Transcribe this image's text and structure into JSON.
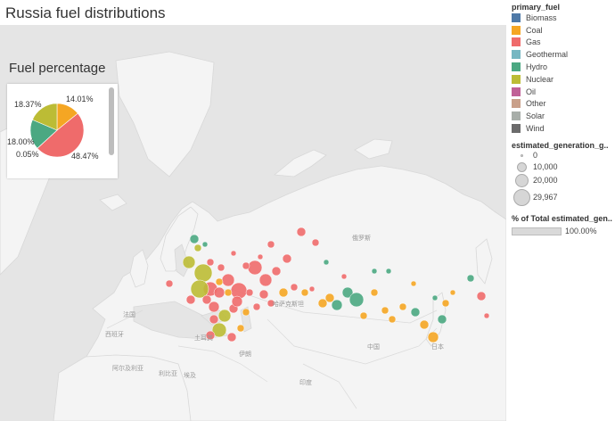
{
  "title": "Russia fuel distributions",
  "inset": {
    "title": "Fuel percentage",
    "labels": {
      "coal": "14.01%",
      "gas": "48.47%",
      "oil": "0.05%",
      "hydro": "18.00%",
      "nuclear": "18.37%"
    }
  },
  "chart_data": {
    "type": "pie",
    "title": "Fuel percentage",
    "slices": [
      {
        "name": "Coal",
        "value": 14.01,
        "color": "#f5a623"
      },
      {
        "name": "Gas",
        "value": 48.47,
        "color": "#ef6b6b"
      },
      {
        "name": "Oil",
        "value": 0.05,
        "color": "#c06096"
      },
      {
        "name": "Hydro",
        "value": 18.0,
        "color": "#4ba882"
      },
      {
        "name": "Nuclear",
        "value": 18.37,
        "color": "#bcbc35"
      }
    ]
  },
  "map_labels": {
    "russia": "俄罗斯",
    "france": "法国",
    "spain": "西班牙",
    "turkey": "土耳其",
    "iran": "伊朗",
    "china": "中国",
    "japan": "日本",
    "algeria": "阿尔及利亚",
    "libya": "利比亚",
    "egypt": "埃及",
    "india": "印度",
    "kazakhstan": "哈萨克斯坦"
  },
  "legend": {
    "color_title": "primary_fuel",
    "items": [
      {
        "label": "Biomass",
        "color": "#4e79a7"
      },
      {
        "label": "Coal",
        "color": "#f5a623"
      },
      {
        "label": "Gas",
        "color": "#ef6b6b"
      },
      {
        "label": "Geothermal",
        "color": "#76b7c2"
      },
      {
        "label": "Hydro",
        "color": "#4ba882"
      },
      {
        "label": "Nuclear",
        "color": "#bcbc35"
      },
      {
        "label": "Oil",
        "color": "#c06096"
      },
      {
        "label": "Other",
        "color": "#c9a08a"
      },
      {
        "label": "Solar",
        "color": "#a8aea9"
      },
      {
        "label": "Wind",
        "color": "#6b6b6b"
      }
    ],
    "size_title": "estimated_generation_g..",
    "sizes": [
      {
        "label": "0",
        "diameter": 3
      },
      {
        "label": "10,000",
        "diameter": 11
      },
      {
        "label": "20,000",
        "diameter": 15
      },
      {
        "label": "29,967",
        "diameter": 19
      }
    ],
    "pct_title": "% of Total estimated_gen..",
    "pct_value": "100.00%"
  }
}
